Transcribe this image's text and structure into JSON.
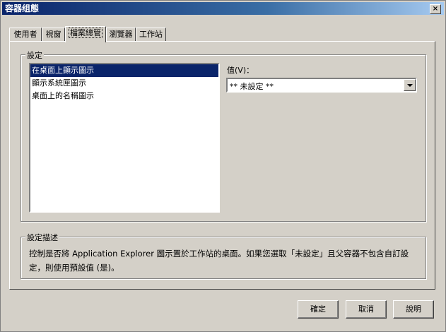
{
  "window": {
    "title": "容器组態",
    "close_label": "×"
  },
  "tabs": [
    {
      "label": "使用者"
    },
    {
      "label": "視窗"
    },
    {
      "label": "檔案總管"
    },
    {
      "label": "瀏覽器"
    },
    {
      "label": "工作站"
    }
  ],
  "settings_group": {
    "label": "設定",
    "items": [
      "在桌面上顯示圖示",
      "顯示系統匣圖示",
      "桌面上的名稱圖示"
    ],
    "selected_index": 0,
    "value_label": "值(V)：",
    "value_selected": "** 未設定 **"
  },
  "description_group": {
    "label": "設定描述",
    "text": "控制是否將 Application Explorer 圖示置於工作站的桌面。如果您選取「未設定」且父容器不包含自訂設定，則使用預設值 (是)。"
  },
  "buttons": {
    "ok": "確定",
    "cancel": "取消",
    "help": "說明"
  }
}
